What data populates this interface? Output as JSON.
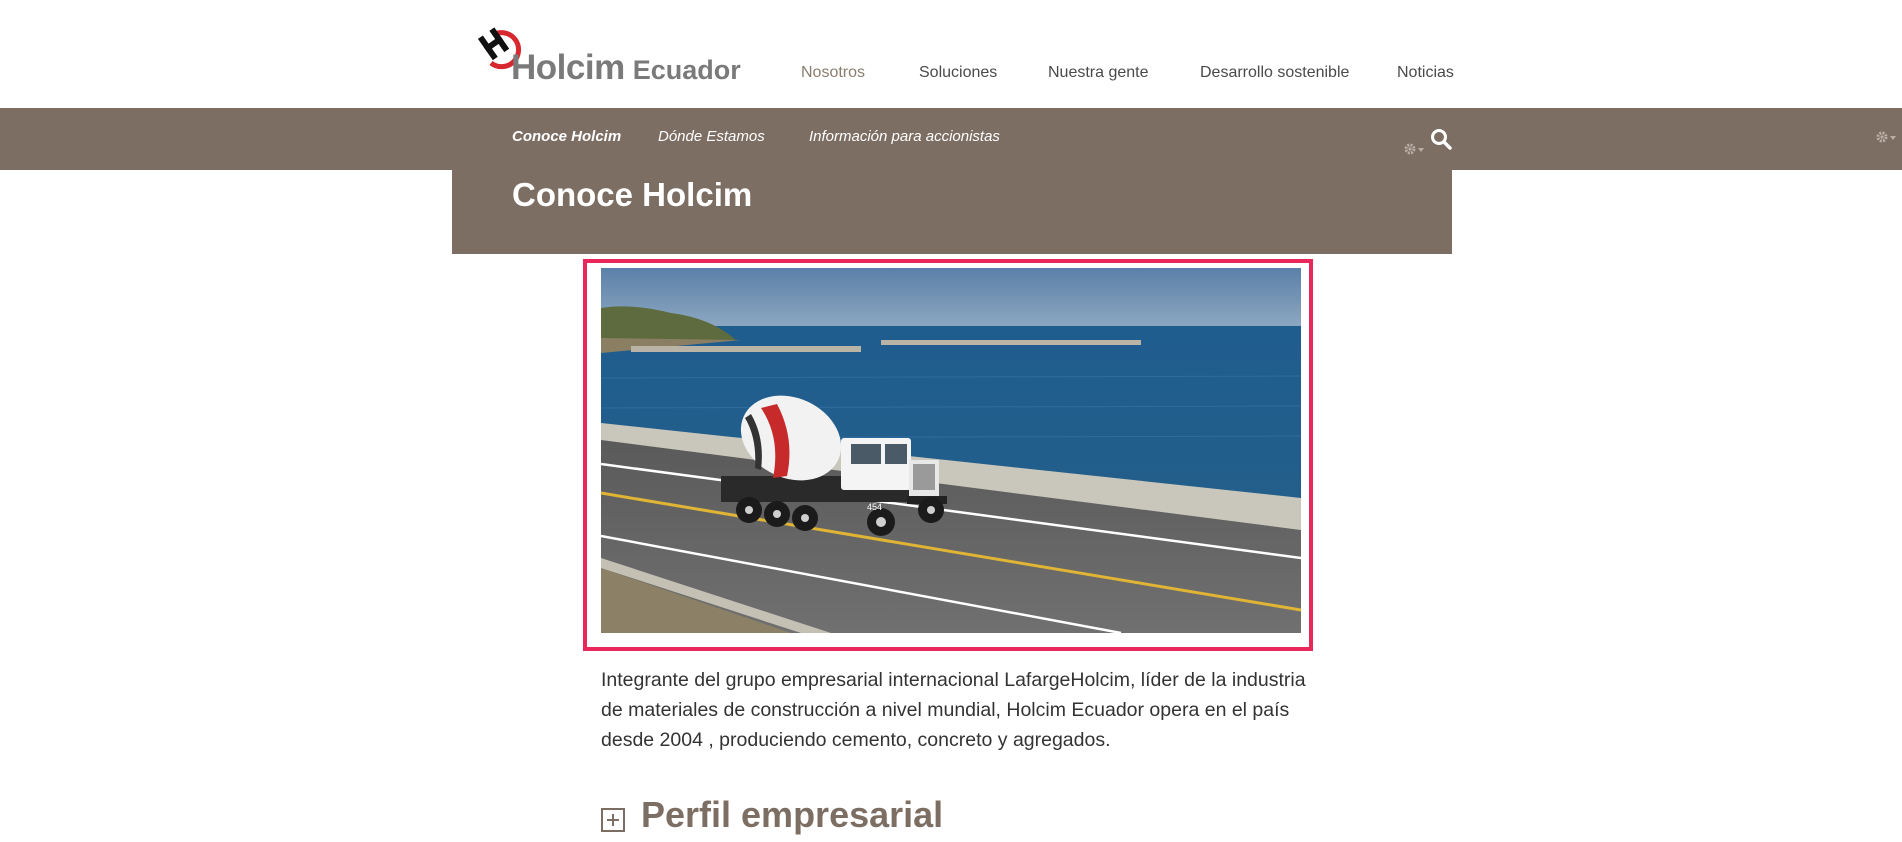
{
  "header": {
    "logo_brand": "Holcim",
    "logo_sub": "Ecuador"
  },
  "main_nav": [
    {
      "label": "Nosotros",
      "active": true
    },
    {
      "label": "Soluciones",
      "active": false
    },
    {
      "label": "Nuestra gente",
      "active": false
    },
    {
      "label": "Desarrollo sostenible",
      "active": false
    },
    {
      "label": "Noticias",
      "active": false
    }
  ],
  "sub_nav": [
    {
      "label": "Conoce Holcim",
      "active": true
    },
    {
      "label": "Dónde Estamos",
      "active": false
    },
    {
      "label": "Información para accionistas",
      "active": false
    }
  ],
  "icons": {
    "search": "search-icon",
    "settings": "gear-icon",
    "expand": "plus-square-icon"
  },
  "page": {
    "title": "Conoce Holcim",
    "intro": "Integrante del grupo empresarial internacional LafargeHolcim, líder de la industria de materiales de construcción a nivel mundial, Holcim Ecuador opera en el país desde 2004 , produciendo cemento, concreto y agregados.",
    "section_title": "Perfil empresarial",
    "hero_truck_number": "454"
  },
  "colors": {
    "brand_brown": "#7d6e63",
    "highlight_border": "#e8285a",
    "logo_red": "#d7282f",
    "text": "#333333"
  }
}
